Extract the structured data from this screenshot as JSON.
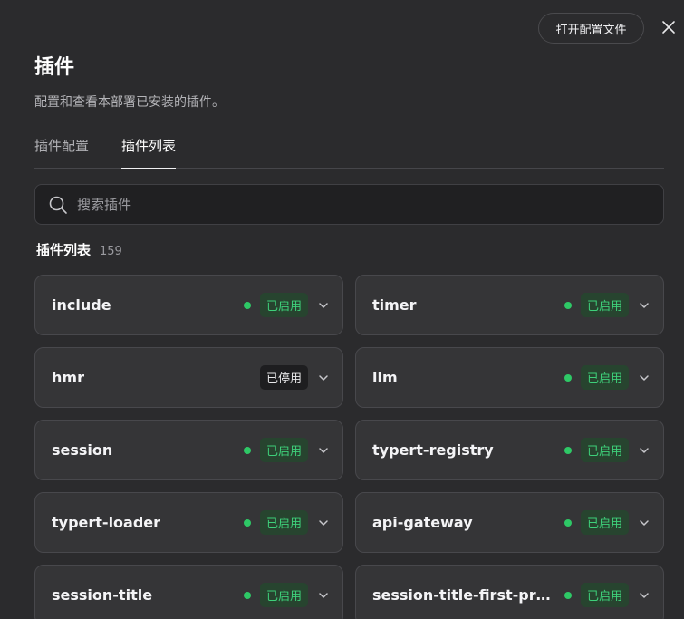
{
  "header": {
    "open_config_label": "打开配置文件",
    "title": "插件",
    "description": "配置和查看本部署已安装的插件。"
  },
  "tabs": [
    {
      "label": "插件配置",
      "active": false
    },
    {
      "label": "插件列表",
      "active": true
    }
  ],
  "search": {
    "placeholder": "搜索插件",
    "value": ""
  },
  "list": {
    "title": "插件列表",
    "count": "159"
  },
  "plugins": [
    {
      "name": "include",
      "status": "已启用",
      "enabled": true
    },
    {
      "name": "timer",
      "status": "已启用",
      "enabled": true
    },
    {
      "name": "hmr",
      "status": "已停用",
      "enabled": false
    },
    {
      "name": "llm",
      "status": "已启用",
      "enabled": true
    },
    {
      "name": "session",
      "status": "已启用",
      "enabled": true
    },
    {
      "name": "typert-registry",
      "status": "已启用",
      "enabled": true
    },
    {
      "name": "typert-loader",
      "status": "已启用",
      "enabled": true
    },
    {
      "name": "api-gateway",
      "status": "已启用",
      "enabled": true
    },
    {
      "name": "session-title",
      "status": "已启用",
      "enabled": true
    },
    {
      "name": "session-title-first-pro...",
      "status": "已启用",
      "enabled": true
    }
  ],
  "colors": {
    "background": "#2b2b2d",
    "card": "#353537",
    "enabled_green": "#2ec866",
    "enabled_badge_bg": "#27442f"
  },
  "icons": {
    "close": "close-icon",
    "search": "search-icon",
    "expand": "chevron-down-icon",
    "status": "status-dot-icon"
  }
}
